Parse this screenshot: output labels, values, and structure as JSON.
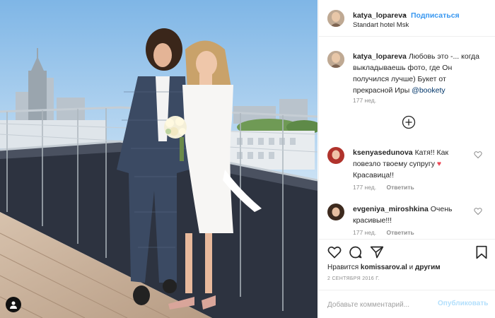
{
  "post": {
    "username": "katya_lopareva",
    "follow_label": "Подписаться",
    "dot": "•",
    "location": "Standart hotel Msk"
  },
  "caption": {
    "username": "katya_lopareva",
    "text": "Любовь это -... когда выкладываешь фото, где Он получился лучше) Букет от прекрасной Иры ",
    "mention": "@bookety",
    "time": "177 нед."
  },
  "comments": [
    {
      "username": "ksenyasedunova",
      "text_before": "Катя!! Как повезло твоему супругу ",
      "heart": "♥",
      "text_after": " Красавица!!",
      "time": "177 нед.",
      "reply_label": "Ответить"
    },
    {
      "username": "evgeniya_miroshkina",
      "text": "Очень красивые!!!",
      "time": "177 нед.",
      "reply_label": "Ответить"
    }
  ],
  "likes": {
    "prefix": "Нравится ",
    "user": "komissarov.al",
    "middle": " и ",
    "others": "другим"
  },
  "date": "2 СЕНТЯБРЯ 2016 Г.",
  "comment_form": {
    "placeholder": "Добавьте комментарий...",
    "publish_label": "Опубликовать"
  },
  "icons": {
    "like": "heart-outline",
    "comment": "speech-bubble",
    "share": "paper-plane",
    "save": "bookmark",
    "load_more": "plus-circle",
    "user_badge": "person-silhouette"
  },
  "colors": {
    "accent": "#3897f0",
    "mention": "#003569",
    "muted": "#8e8e8e",
    "heart": "#ed4956"
  }
}
